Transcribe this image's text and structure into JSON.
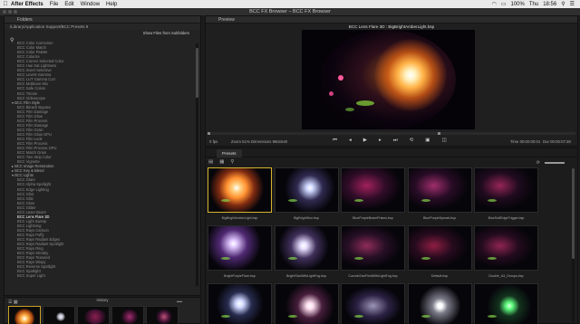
{
  "menubar": {
    "apple": "",
    "app": "After Effects",
    "items": [
      "File",
      "Edit",
      "Window",
      "Help"
    ],
    "status": {
      "battery": "100%",
      "day": "Thu",
      "time": "18:56"
    }
  },
  "window": {
    "title": "BCC FX Browser – BCC FX Browser"
  },
  "folders": {
    "tab": "Folders",
    "path": "/Library/Application Support/BCC Presets 9",
    "show_subfolders": "Show Files from Subfolders",
    "items": [
      {
        "label": "BCC Color Correction",
        "kind": "sub"
      },
      {
        "label": "BCC Color Match",
        "kind": "sub"
      },
      {
        "label": "BCC Color Palette",
        "kind": "sub"
      },
      {
        "label": "BCC Colorize",
        "kind": "sub"
      },
      {
        "label": "BCC Correct Selected Color",
        "kind": "sub"
      },
      {
        "label": "BCC Hue Sat Lightness",
        "kind": "sub"
      },
      {
        "label": "BCC Invert Selective",
        "kind": "sub"
      },
      {
        "label": "BCC Levels Gamma",
        "kind": "sub"
      },
      {
        "label": "BCC LUT Gamma Corr",
        "kind": "sub"
      },
      {
        "label": "BCC Multitone Mix",
        "kind": "sub"
      },
      {
        "label": "BCC Safe Colors",
        "kind": "sub"
      },
      {
        "label": "BCC Tritone",
        "kind": "sub"
      },
      {
        "label": "BCC Videoscope",
        "kind": "sub"
      },
      {
        "label": "▾ BCC Film Style",
        "kind": "cat"
      },
      {
        "label": "BCC Bleach Bypass",
        "kind": "sub"
      },
      {
        "label": "BCC Film Damage",
        "kind": "sub"
      },
      {
        "label": "BCC Film Glow",
        "kind": "sub"
      },
      {
        "label": "BCC Film Process",
        "kind": "sub"
      },
      {
        "label": "BCC Film Damage",
        "kind": "sub"
      },
      {
        "label": "BCC Film Grain",
        "kind": "sub"
      },
      {
        "label": "BCC Film Glow GPU",
        "kind": "sub"
      },
      {
        "label": "BCC Film Look",
        "kind": "sub"
      },
      {
        "label": "BCC Film Process",
        "kind": "sub"
      },
      {
        "label": "BCC Film Process GPU",
        "kind": "sub"
      },
      {
        "label": "BCC Match Grain",
        "kind": "sub"
      },
      {
        "label": "BCC Two Strip Color",
        "kind": "sub"
      },
      {
        "label": "BCC Vignette",
        "kind": "sub"
      },
      {
        "label": "▸ BCC Image Restoration",
        "kind": "cat"
      },
      {
        "label": "▸ BCC Key & Blend",
        "kind": "cat"
      },
      {
        "label": "▾ BCC Lights",
        "kind": "cat"
      },
      {
        "label": "BCC Glare",
        "kind": "sub"
      },
      {
        "label": "BCC Alpha Spotlight",
        "kind": "sub"
      },
      {
        "label": "BCC Edge Lighting",
        "kind": "sub"
      },
      {
        "label": "BCC Glint",
        "kind": "sub"
      },
      {
        "label": "BCC Glitz",
        "kind": "sub"
      },
      {
        "label": "BCC Glow",
        "kind": "sub"
      },
      {
        "label": "BCC Glitter",
        "kind": "sub"
      },
      {
        "label": "BCC Laser Beam",
        "kind": "sub"
      },
      {
        "label": "BCC Lens Flare 3D",
        "kind": "selected"
      },
      {
        "label": "BCC Light Sweep",
        "kind": "sub"
      },
      {
        "label": "BCC Lightning",
        "kind": "sub"
      },
      {
        "label": "BCC Rays Cartoon",
        "kind": "sub"
      },
      {
        "label": "BCC Rays Puffy",
        "kind": "sub"
      },
      {
        "label": "BCC Rays Radiant Edges",
        "kind": "sub"
      },
      {
        "label": "BCC Rays Radiant Spotlight",
        "kind": "sub"
      },
      {
        "label": "BCC Rays Ring",
        "kind": "sub"
      },
      {
        "label": "BCC Rays Streaky",
        "kind": "sub"
      },
      {
        "label": "BCC Rays Textured",
        "kind": "sub"
      },
      {
        "label": "BCC Rays Wispy",
        "kind": "sub"
      },
      {
        "label": "BCC Reverse Spotlight",
        "kind": "sub"
      },
      {
        "label": "BCC Spotlight",
        "kind": "sub"
      },
      {
        "label": "BCC Super Light",
        "kind": "sub"
      }
    ]
  },
  "history": {
    "tab": "History"
  },
  "preview": {
    "tab": "Preview",
    "title": "BCC Lens Flare 3D : BigBrightAmberLight.bsp",
    "fps": "0 fps",
    "zoom": "Zoom 51%",
    "dimensions": "Dimensions 960x540",
    "time": "Time  00:00:00:01",
    "duration": "Dur  00:00:07:28"
  },
  "presets": {
    "tab": "Presets",
    "items": [
      {
        "label": "BigBrightAmberLight.bsp",
        "selected": true
      },
      {
        "label": "BigBrightSun.bsp",
        "selected": false
      },
      {
        "label": "BluePurpleBeamPrisms.bsp",
        "selected": false
      },
      {
        "label": "BluePurpleSpread.bsp",
        "selected": false
      },
      {
        "label": "BlueSoftEdgeTrigger.bsp",
        "selected": false
      },
      {
        "label": "BrightPurpleFlare.bsp",
        "selected": false
      },
      {
        "label": "BrightStarWithLightFog.bsp",
        "selected": false
      },
      {
        "label": "CosmicStarFieldWithLightFog.bsp",
        "selected": false
      },
      {
        "label": "Default.bsp",
        "selected": false
      },
      {
        "label": "Double_A3_Groups.bsp",
        "selected": false
      },
      {
        "label": "",
        "selected": false
      },
      {
        "label": "",
        "selected": false
      },
      {
        "label": "",
        "selected": false
      },
      {
        "label": "",
        "selected": false
      },
      {
        "label": "",
        "selected": false
      }
    ]
  },
  "colors": {
    "accent_selected": "#d8b52d",
    "panel": "#232323",
    "background": "#1c1c1c"
  },
  "icons": [
    "apple-icon",
    "search-icon",
    "list-view-icon",
    "grid-view-icon",
    "refresh-icon",
    "play-icon",
    "step-back-icon",
    "step-forward-icon",
    "goto-start-icon",
    "goto-end-icon",
    "loop-icon"
  ]
}
